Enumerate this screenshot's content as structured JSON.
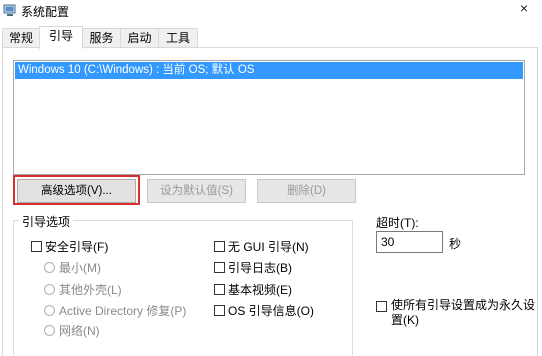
{
  "window": {
    "title": "系统配置",
    "icon": "system-config-icon",
    "close_glyph": "×"
  },
  "tabs": [
    {
      "label": "常规",
      "active": false
    },
    {
      "label": "引导",
      "active": true
    },
    {
      "label": "服务",
      "active": false
    },
    {
      "label": "启动",
      "active": false
    },
    {
      "label": "工具",
      "active": false
    }
  ],
  "os_list": {
    "items": [
      "Windows 10 (C:\\Windows) : 当前 OS; 默认 OS"
    ],
    "selected": 0
  },
  "buttons": {
    "advanced": "高级选项(V)...",
    "set_default": "设为默认值(S)",
    "delete": "删除(D)"
  },
  "boot_options": {
    "group_title": "引导选项",
    "safe_boot": "安全引导(F)",
    "minimal": "最小(M)",
    "alternate_shell": "其他外壳(L)",
    "active_directory": "Active Directory 修复(P)",
    "network": "网络(N)",
    "no_gui": "无 GUI 引导(N)",
    "boot_log": "引导日志(B)",
    "base_video": "基本视频(E)",
    "os_info": "OS 引导信息(O)"
  },
  "timeout": {
    "label": "超时(T):",
    "value": "30",
    "unit": "秒"
  },
  "make_permanent": "使所有引导设置成为永久设置(K)",
  "colors": {
    "selection": "#3399ff",
    "highlight_box": "#d63030"
  }
}
